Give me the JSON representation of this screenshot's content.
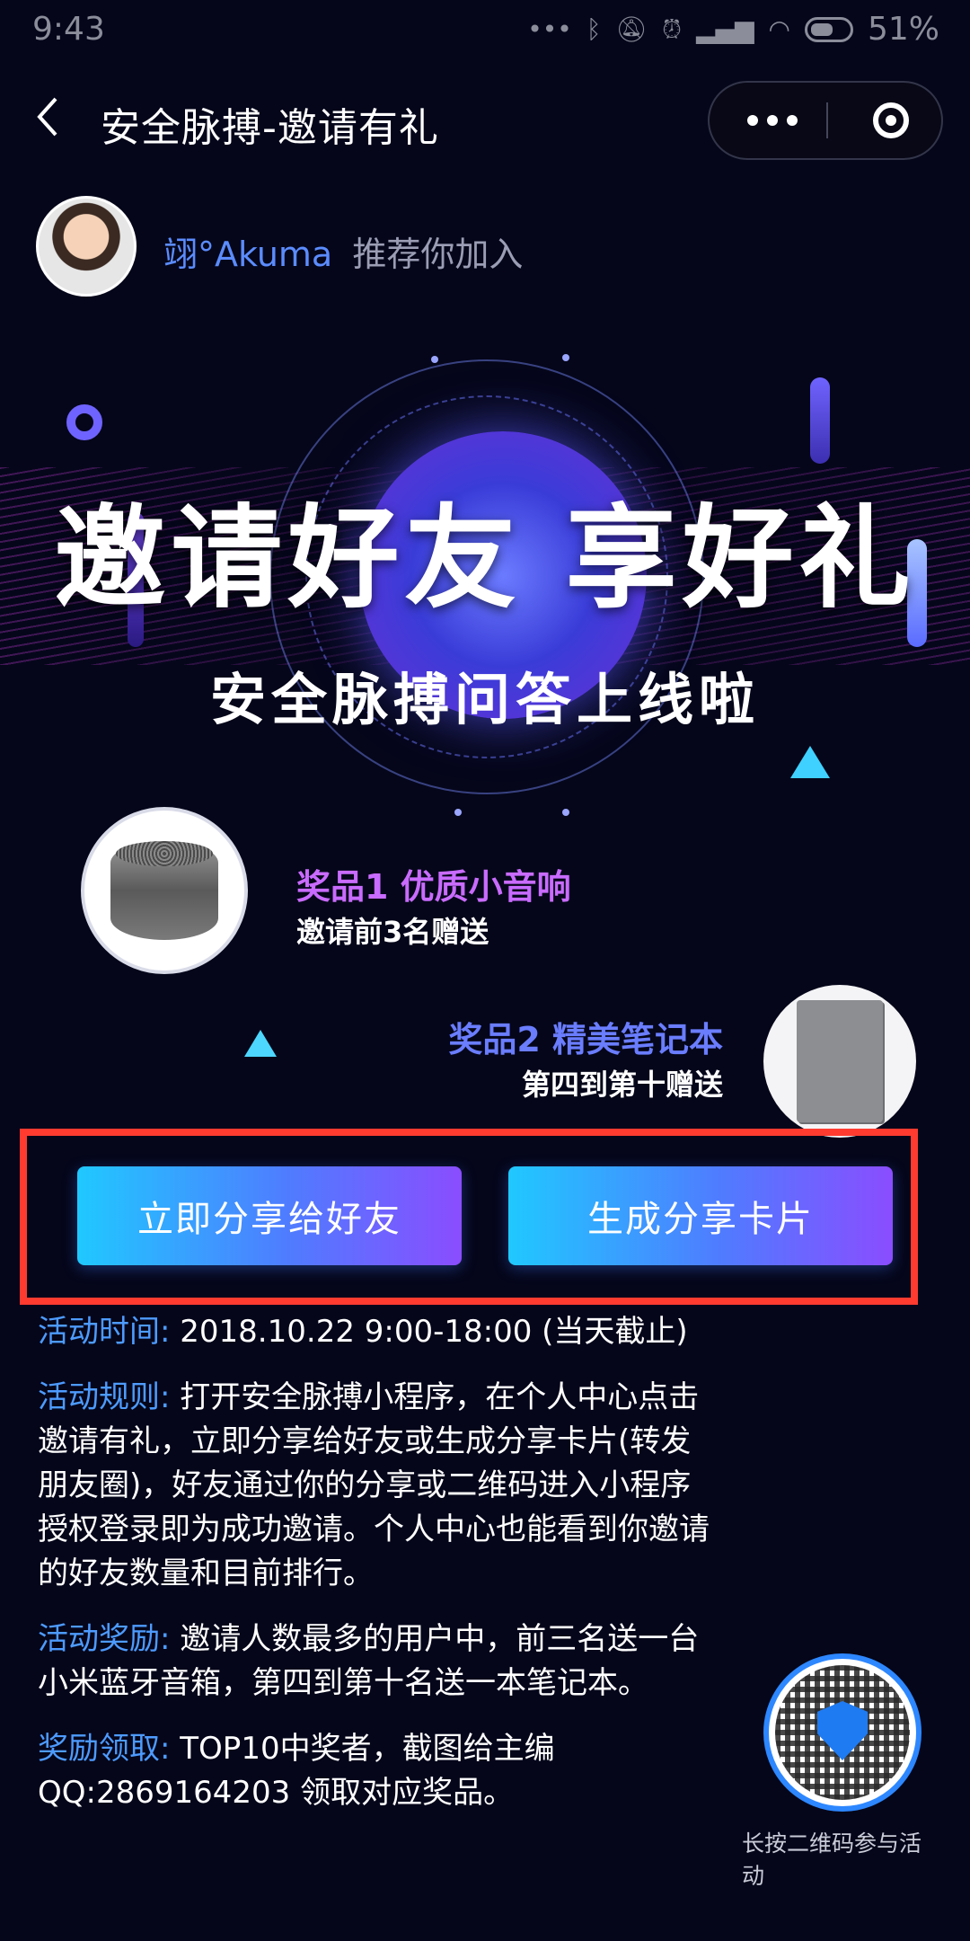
{
  "status_bar": {
    "time": "9:43",
    "battery_percent": "51%",
    "icons": [
      "more-dots-icon",
      "bluetooth-icon",
      "mute-icon",
      "alarm-icon",
      "signal-icon",
      "wifi-icon",
      "battery-icon"
    ]
  },
  "nav": {
    "title": "安全脉搏-邀请有礼"
  },
  "inviter": {
    "name": "翊°Akuma",
    "text": "推荐你加入"
  },
  "banner": {
    "title": "邀请好友 享好礼",
    "subtitle": "安全脉搏问答上线啦"
  },
  "prizes": [
    {
      "title": "奖品1 优质小音响",
      "desc": "邀请前3名赠送"
    },
    {
      "title": "奖品2 精美笔记本",
      "desc": "第四到第十赠送"
    }
  ],
  "buttons": {
    "share_label": "立即分享给好友",
    "card_label": "生成分享卡片"
  },
  "rules": [
    {
      "label": "活动时间",
      "text": "2018.10.22 9:00-18:00 (当天截止)"
    },
    {
      "label": "活动规则",
      "text": "打开安全脉搏小程序，在个人中心点击邀请有礼，立即分享给好友或生成分享卡片(转发朋友圈)，好友通过你的分享或二维码进入小程序授权登录即为成功邀请。个人中心也能看到你邀请的好友数量和目前排行。"
    },
    {
      "label": "活动奖励",
      "text": "邀请人数最多的用户中，前三名送一台小米蓝牙音箱，第四到第十名送一本笔记本。"
    },
    {
      "label": "奖励领取",
      "text": "TOP10中奖者，截图给主编QQ:2869164203 领取对应奖品。"
    }
  ],
  "qr": {
    "caption": "长按二维码参与活动"
  },
  "colors": {
    "background": "#05061a",
    "accent_blue": "#4d9bff",
    "prize1_purple": "#c96bff",
    "prize2_blue": "#6a7dff",
    "highlight_red": "#ff3b30"
  }
}
